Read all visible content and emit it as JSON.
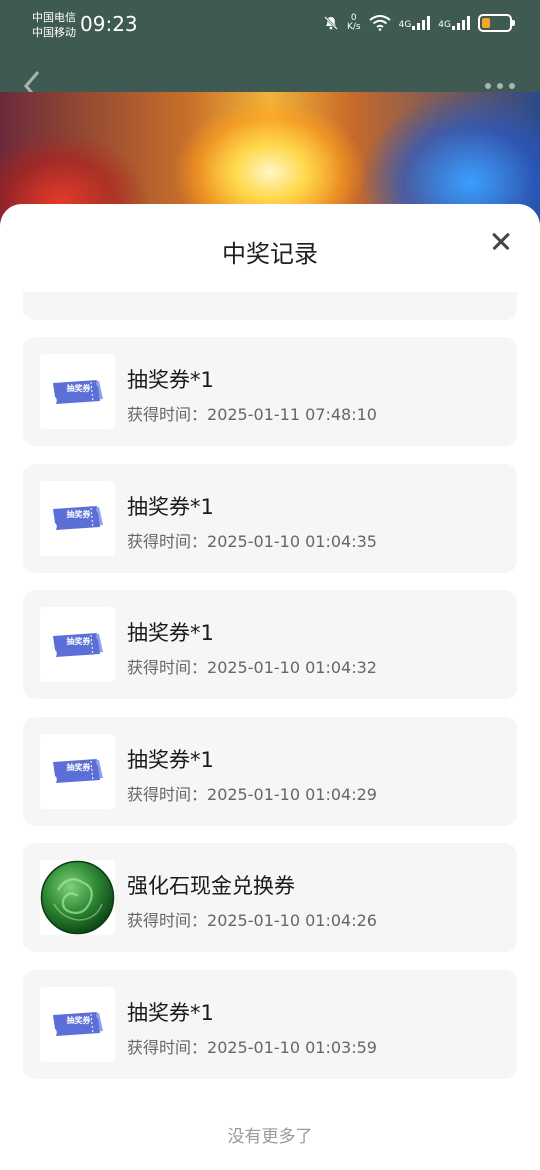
{
  "status_bar": {
    "carrier_1": "中国电信",
    "carrier_2": "中国移动",
    "time": "09:23",
    "net_speed_value": "0",
    "net_speed_unit": "K/s",
    "signal_1": "4G",
    "signal_2": "4G",
    "battery_level_percent": 30
  },
  "header": {
    "back_icon": "chevron-left-icon",
    "more_icon": "more-dots-icon"
  },
  "modal": {
    "title": "中奖记录",
    "close_icon": "close-icon",
    "time_label": "获得时间：",
    "records": [
      {
        "name": "抽奖券*1",
        "time": "2025-01-11 07:48:10",
        "icon": "ticket"
      },
      {
        "name": "抽奖券*1",
        "time": "2025-01-10 01:04:35",
        "icon": "ticket"
      },
      {
        "name": "抽奖券*1",
        "time": "2025-01-10 01:04:32",
        "icon": "ticket"
      },
      {
        "name": "抽奖券*1",
        "time": "2025-01-10 01:04:29",
        "icon": "ticket"
      },
      {
        "name": "强化石现金兑换券",
        "time": "2025-01-10 01:04:26",
        "icon": "jade-stone"
      },
      {
        "name": "抽奖券*1",
        "time": "2025-01-10 01:03:59",
        "icon": "ticket"
      }
    ],
    "ticket_text": "抽奖券",
    "footer": "没有更多了"
  },
  "colors": {
    "header_bg": "#3f5a52",
    "card_bg": "#f6f6f6",
    "ticket_blue": "#5b6fd6"
  }
}
